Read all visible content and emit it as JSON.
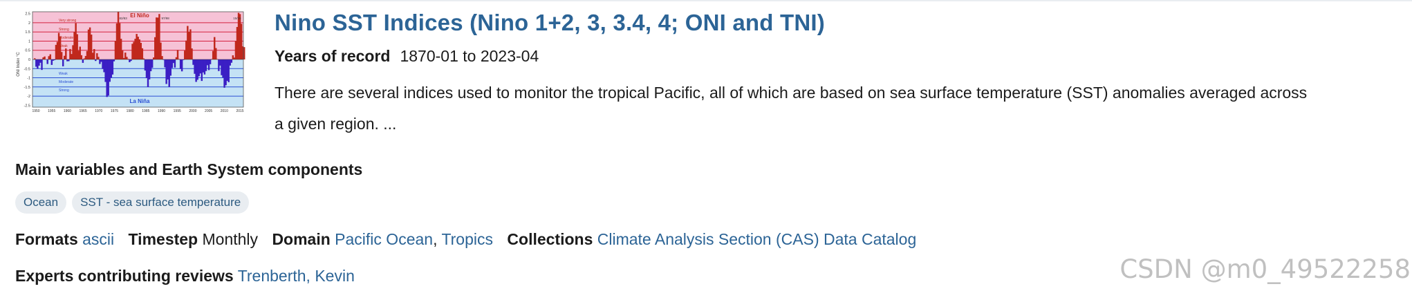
{
  "entry": {
    "title": "Nino SST Indices (Nino 1+2, 3, 3.4, 4; ONI and TNI)",
    "years_label": "Years of record",
    "years_value": "1870-01 to 2023-04",
    "description_line1": "There are several indices used to monitor the tropical Pacific, all of which are based on sea surface temperature (SST) anomalies averaged across",
    "description_line2": "a given region. ..."
  },
  "thumbnail": {
    "title_top": "El Niño",
    "title_bottom": "La Niña",
    "ylabel": "ONI Index °C",
    "band_labels": [
      "Very strong",
      "Strong",
      "Moderate",
      "Weak",
      "Weak",
      "Moderate",
      "Strong"
    ],
    "event_labels": [
      "82/83",
      "97/98",
      "15/16"
    ],
    "y_ticks": [
      "2.5",
      "2",
      "1.5",
      "1",
      "0.5",
      "0",
      "-0.5",
      "-1",
      "-1.5",
      "-2",
      "-2.5"
    ],
    "x_ticks": [
      "1950",
      "1955",
      "1960",
      "1965",
      "1970",
      "1975",
      "1980",
      "1985",
      "1990",
      "1995",
      "2000",
      "2005",
      "2010",
      "2015"
    ],
    "colors": {
      "warm_fill": "#c0281d",
      "cold_fill": "#3b1fc4",
      "warm_band": "#f6c2d6",
      "cold_band": "#c4e2f5",
      "threshold_warm": "#d4213f",
      "threshold_cold": "#2a4ed3"
    }
  },
  "components": {
    "heading": "Main variables and Earth System components",
    "tags": [
      "Ocean",
      "SST - sea surface temperature"
    ]
  },
  "meta": {
    "formats_label": "Formats",
    "formats_value": "ascii",
    "timestep_label": "Timestep",
    "timestep_value": "Monthly",
    "domain_label": "Domain",
    "domain_values": [
      "Pacific Ocean",
      "Tropics"
    ],
    "domain_separator": ",",
    "collections_label": "Collections",
    "collections_value": "Climate Analysis Section (CAS) Data Catalog",
    "experts_label": "Experts contributing reviews",
    "experts_value": "Trenberth, Kevin"
  },
  "watermark": "CSDN @m0_49522258",
  "colors": {
    "title_link": "#2c6496",
    "tag_bg": "#e9edf1",
    "tag_text": "#2c5a80",
    "text": "#1b1b1b"
  }
}
